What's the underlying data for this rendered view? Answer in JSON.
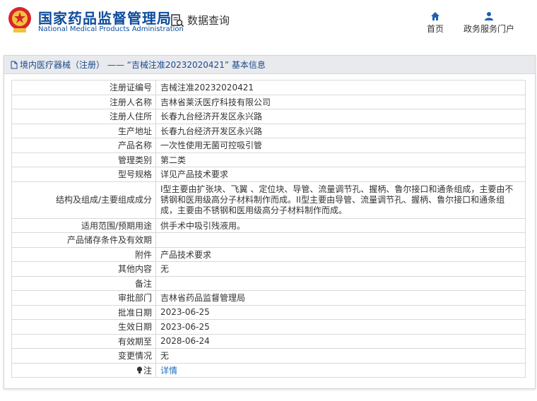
{
  "header": {
    "title_cn": "国家药品监督管理局",
    "title_en": "National Medical Products Administration",
    "query_label": "数据查询",
    "nav": [
      {
        "label": "首页",
        "icon": "home-icon"
      },
      {
        "label": "政务服务门户",
        "icon": "user-icon"
      }
    ]
  },
  "panel": {
    "title": "境内医疗器械（注册） —— “吉械注准20232020421” 基本信息"
  },
  "rows": [
    {
      "label": "注册证编号",
      "value": "吉械注准20232020421"
    },
    {
      "label": "注册人名称",
      "value": "吉林省莱沃医疗科技有限公司"
    },
    {
      "label": "注册人住所",
      "value": "长春九台经济开发区永兴路"
    },
    {
      "label": "生产地址",
      "value": "长春九台经济开发区永兴路"
    },
    {
      "label": "产品名称",
      "value": "一次性使用无菌可控吸引管"
    },
    {
      "label": "管理类别",
      "value": "第二类"
    },
    {
      "label": "型号规格",
      "value": "详见产品技术要求"
    },
    {
      "label": "结构及组成/主要组成成分",
      "value": "I型主要由扩张块、飞翼 、定位块、导管、流量调节孔、握柄、鲁尔接口和通条组成，主要由不锈钢和医用级高分子材料制作而成。II型主要由导管、流量调节孔、握柄、鲁尔接口和通条组成，主要由不锈钢和医用级高分子材料制作而成。"
    },
    {
      "label": "适用范围/预期用途",
      "value": "供手术中吸引残液用。"
    },
    {
      "label": "产品储存条件及有效期",
      "value": ""
    },
    {
      "label": "附件",
      "value": "产品技术要求"
    },
    {
      "label": "其他内容",
      "value": "无"
    },
    {
      "label": "备注",
      "value": ""
    },
    {
      "label": "审批部门",
      "value": "吉林省药品监督管理局"
    },
    {
      "label": "批准日期",
      "value": "2023-06-25"
    },
    {
      "label": "生效日期",
      "value": "2023-06-25"
    },
    {
      "label": "有效期至",
      "value": "2028-06-24"
    },
    {
      "label": "变更情况",
      "value": "无"
    },
    {
      "label": "注",
      "value": "详情"
    }
  ],
  "colors": {
    "brand": "#0d4c9c",
    "link": "#1e6fbf",
    "panel_head_bg": "#e9eaee"
  }
}
